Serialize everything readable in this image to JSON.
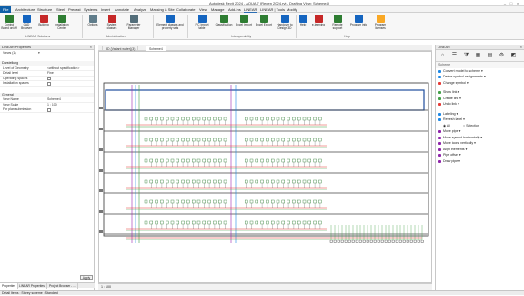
{
  "window": {
    "title": "Autodesk Revit 2024 - AQUA 7 (Regen 2024.rvt - Drafting View: Scheme4)",
    "controls": [
      "minimize-icon",
      "maximize-icon",
      "close-icon"
    ]
  },
  "menubar": {
    "items": [
      "File",
      "Architecture",
      "Structure",
      "Steel",
      "Precast",
      "Systems",
      "Insert",
      "Annotate",
      "Analyze",
      "Massing & Site",
      "Collaborate",
      "View",
      "Manage",
      "Add-Ins",
      "LINEAR",
      "LINEAR | Tools",
      "Modify"
    ],
    "active": "LINEAR"
  },
  "ribbon": {
    "buttons": [
      {
        "label": "Control Board on/off",
        "icon": "control-board-icon",
        "color": "#2e7d32"
      },
      {
        "label": "CAD Browser",
        "icon": "cad-browser-icon",
        "color": "#1565c0"
      },
      {
        "label": "Building",
        "icon": "building-icon",
        "color": "#c62828"
      },
      {
        "label": "Installation Center",
        "icon": "installation-center-icon",
        "color": "#2e7d32"
      },
      {
        "label": "Options",
        "icon": "gear-icon",
        "color": "#607d8b"
      },
      {
        "label": "System classes",
        "icon": "system-classes-icon",
        "color": "#c62828"
      },
      {
        "label": "Parameter Manager",
        "icon": "parameter-manager-icon",
        "color": "#546e7a"
      },
      {
        "label": "Element classes and property sets",
        "icon": "element-classes-icon",
        "color": "#1565c0"
      },
      {
        "label": "IFC Import table",
        "icon": "ifc-import-icon",
        "color": "#1565c0"
      },
      {
        "label": "Classification",
        "icon": "classification-icon",
        "color": "#2e7d32"
      },
      {
        "label": "Excel Import",
        "icon": "excel-import-icon",
        "color": "#2e7d32"
      },
      {
        "label": "Excel Export",
        "icon": "excel-export-icon",
        "color": "#2e7d32"
      },
      {
        "label": "Handover to Design 3D",
        "icon": "handover-icon",
        "color": "#1565c0"
      },
      {
        "label": "Help",
        "icon": "help-icon",
        "color": "#1565c0"
      },
      {
        "label": "e-learning",
        "icon": "e-learning-icon",
        "color": "#c62828"
      },
      {
        "label": "Remote support",
        "icon": "remote-support-icon",
        "color": "#2e7d32"
      },
      {
        "label": "Program info",
        "icon": "info-icon",
        "color": "#1565c0"
      },
      {
        "label": "Program licenses",
        "icon": "key-icon",
        "color": "#f9a825"
      }
    ],
    "groups": [
      "LINEAR Solutions",
      "Administration",
      "Interoperability",
      "Help"
    ]
  },
  "properties": {
    "header": "LINEAR Properties",
    "type_selector": "Views (1)",
    "sections": [
      {
        "title": "Darstellung",
        "rows": [
          {
            "label": "Level of Geometry",
            "value": "<without specification>"
          },
          {
            "label": "Detail level",
            "value": "Fine"
          },
          {
            "label": "Operating spaces",
            "value": "",
            "checkbox": true
          },
          {
            "label": "Installation spaces",
            "value": "",
            "checkbox": true
          }
        ]
      },
      {
        "title": "General",
        "rows": [
          {
            "label": "View Name",
            "value": "Scheme4"
          },
          {
            "label": "View Scale",
            "value": "1 : 100"
          },
          {
            "label": "For plan submission",
            "value": "",
            "checkbox": true
          }
        ]
      }
    ],
    "apply_label": "Apply",
    "bottom_tabs": [
      "Properties",
      "LINEAR Properties",
      "Project Browser - ..."
    ]
  },
  "view_tabs": [
    {
      "label": "3D {Variant water}(3)",
      "active": false
    },
    {
      "label": "Scheme4",
      "active": true
    }
  ],
  "view_control": {
    "scale": "1 : 100"
  },
  "linear_panel": {
    "header": "LINEAR",
    "section": "Scheme",
    "items": [
      {
        "label": "Convert model to scheme",
        "color": "#1e88e5",
        "dropdown": true
      },
      {
        "label": "Define symbol assignments",
        "color": "#1e88e5",
        "dropdown": true
      },
      {
        "label": "Change symbol",
        "color": "#e53935",
        "dropdown": true
      },
      {
        "label": "Show link",
        "color": "#43a047",
        "dropdown": true
      },
      {
        "label": "Create link",
        "color": "#43a047",
        "dropdown": true
      },
      {
        "label": "Undo link",
        "color": "#e53935",
        "dropdown": true
      },
      {
        "label": "Labeling",
        "color": "#1e88e5",
        "dropdown": true
      },
      {
        "label": "Refresh label",
        "color": "#1e88e5",
        "dropdown": true
      },
      {
        "label": "Move pipe",
        "color": "#8e24aa",
        "dropdown": true
      },
      {
        "label": "Move symbol horizontally",
        "color": "#8e24aa",
        "dropdown": true
      },
      {
        "label": "Move icons vertically",
        "color": "#8e24aa",
        "dropdown": true
      },
      {
        "label": "Align elements",
        "color": "#8e24aa",
        "dropdown": true
      },
      {
        "label": "Pipe offset",
        "color": "#8e24aa",
        "dropdown": true
      },
      {
        "label": "Draw pipe",
        "color": "#8e24aa",
        "dropdown": true
      }
    ],
    "radio": {
      "options": [
        "All",
        "Selection"
      ],
      "selected": "All"
    }
  },
  "status": {
    "text": "Detail Items : Storey scheme : Standard"
  }
}
